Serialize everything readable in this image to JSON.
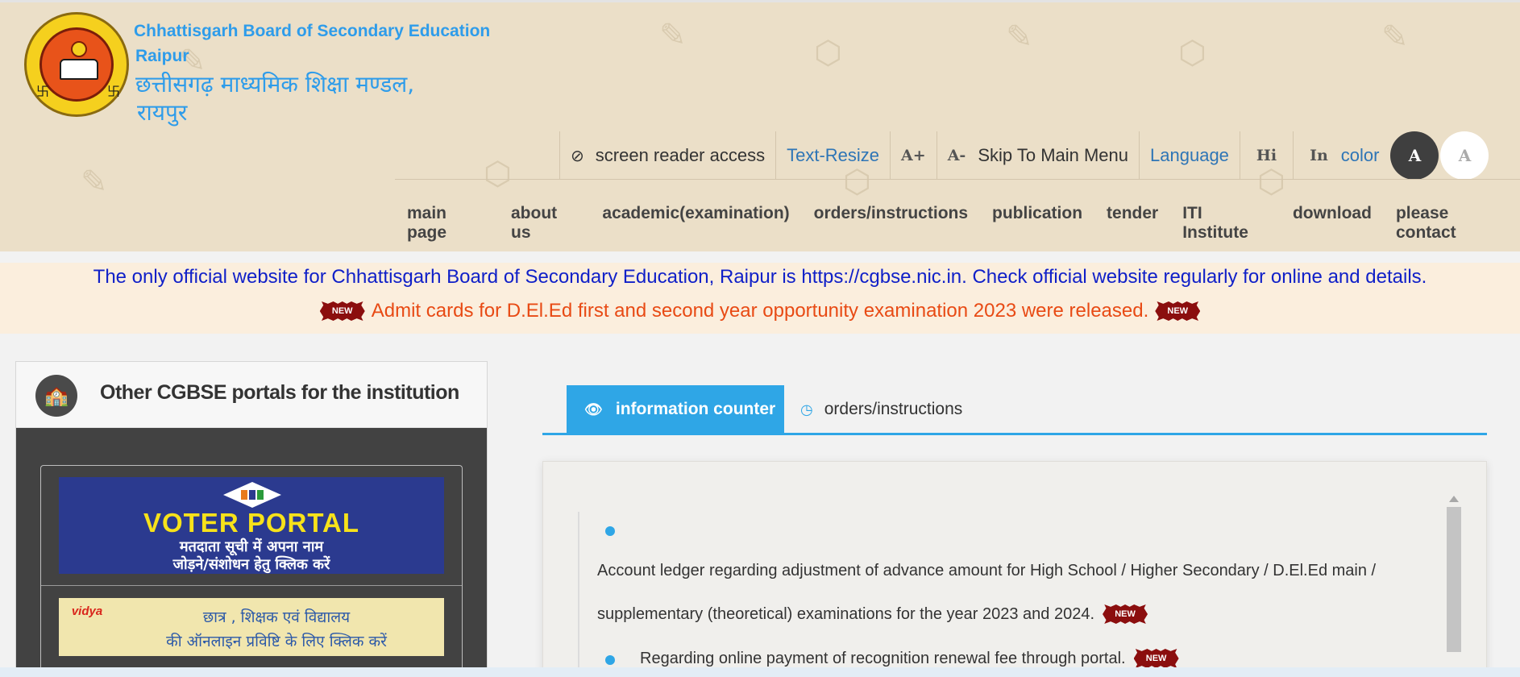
{
  "brand": {
    "name_en_line1": "Chhattisgarh Board of Secondary Education",
    "name_en_line2": "Raipur",
    "name_hi_line1": "छत्तीसगढ़ माध्यमिक शिक्षा मण्डल,",
    "name_hi_line2": "रायपुर"
  },
  "accessibility": {
    "screen_reader": "screen reader access",
    "text_resize": "Text-Resize",
    "increase": "A+",
    "decrease": "A-",
    "skip": "Skip To Main Menu",
    "language": "Language",
    "lang_hi": "Hi",
    "lang_en": "In",
    "color": "color",
    "contrast_dark": "A",
    "contrast_light": "A"
  },
  "nav": {
    "items": [
      "main page",
      "about us",
      "academic(examination)",
      "orders/instructions",
      "publication",
      "tender",
      "ITI Institute",
      "download",
      "please contact"
    ]
  },
  "notice": {
    "line1": "The only official website for Chhattisgarh Board of Secondary Education, Raipur is https://cgbse.nic.in. Check official website regularly for online and details.",
    "line2": "Admit cards for D.El.Ed first and second year opportunity examination 2023 were released.",
    "new_badge": "NEW"
  },
  "portals": {
    "title": "Other CGBSE portals for the institution",
    "voter_title": "VOTER PORTAL",
    "voter_line1": "मतदाता सूची में अपना नाम",
    "voter_line2": "जोड़ने/संशोधन हेतु क्लिक करें",
    "vidya_badge": "vidya",
    "vidya_line1": "छात्र , शिक्षक एवं विद्यालय",
    "vidya_line2": "की ऑनलाइन प्रविष्टि के लिए क्लिक करें"
  },
  "tabs": {
    "items": [
      "information counter",
      "orders/instructions"
    ],
    "active": "information counter"
  },
  "content": {
    "items": [
      "Account ledger regarding adjustment of advance amount for High School / Higher Secondary / D.El.Ed main /",
      "supplementary (theoretical) examinations for the year 2023 and 2024.",
      "Regarding online payment of recognition renewal fee through portal."
    ],
    "new_badge": "NEW"
  },
  "colors": {
    "accent": "#2fa6e6",
    "brand_blue": "#2e9cea",
    "notice_blue": "#1020c8",
    "notice_orange": "#e84a14",
    "header_bg": "#ebdfc8"
  }
}
